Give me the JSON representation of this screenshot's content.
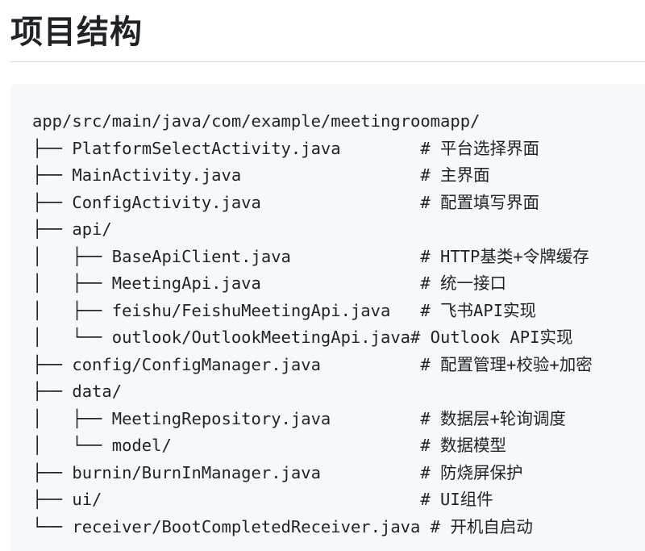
{
  "page": {
    "title": "项目结构"
  },
  "code_block": {
    "lines": [
      "app/src/main/java/com/example/meetingroomapp/",
      "├── PlatformSelectActivity.java        # 平台选择界面",
      "├── MainActivity.java                  # 主界面",
      "├── ConfigActivity.java                # 配置填写界面",
      "├── api/",
      "│   ├── BaseApiClient.java             # HTTP基类+令牌缓存",
      "│   ├── MeetingApi.java                # 统一接口",
      "│   ├── feishu/FeishuMeetingApi.java   # 飞书API实现",
      "│   └── outlook/OutlookMeetingApi.java# Outlook API实现",
      "├── config/ConfigManager.java          # 配置管理+校验+加密",
      "├── data/",
      "│   ├── MeetingRepository.java         # 数据层+轮询调度",
      "│   └── model/                         # 数据模型",
      "├── burnin/BurnInManager.java          # 防烧屏保护",
      "├── ui/                                # UI组件",
      "└── receiver/BootCompletedReceiver.java # 开机自启动"
    ]
  }
}
